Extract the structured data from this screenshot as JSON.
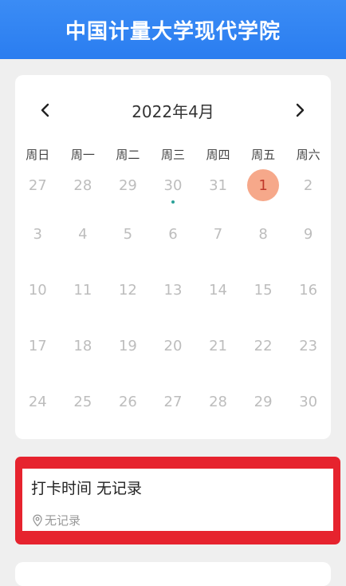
{
  "header": {
    "title": "中国计量大学现代学院"
  },
  "calendar": {
    "month_label": "2022年4月",
    "weekdays": [
      "周日",
      "周一",
      "周二",
      "周三",
      "周四",
      "周五",
      "周六"
    ],
    "weeks": [
      [
        "27",
        "28",
        "29",
        "30",
        "31",
        "1",
        "2"
      ],
      [
        "3",
        "4",
        "5",
        "6",
        "7",
        "8",
        "9"
      ],
      [
        "10",
        "11",
        "12",
        "13",
        "14",
        "15",
        "16"
      ],
      [
        "17",
        "18",
        "19",
        "20",
        "21",
        "22",
        "23"
      ],
      [
        "24",
        "25",
        "26",
        "27",
        "28",
        "29",
        "30"
      ]
    ],
    "selected_day": "1",
    "colors": {
      "selected": "#f6a88a",
      "marker_dot": "#2aa198"
    }
  },
  "record": {
    "title": "打卡时间 无记录",
    "location": "无记录",
    "location_icon": "location-pin-icon",
    "highlight_color": "#e6232e"
  }
}
